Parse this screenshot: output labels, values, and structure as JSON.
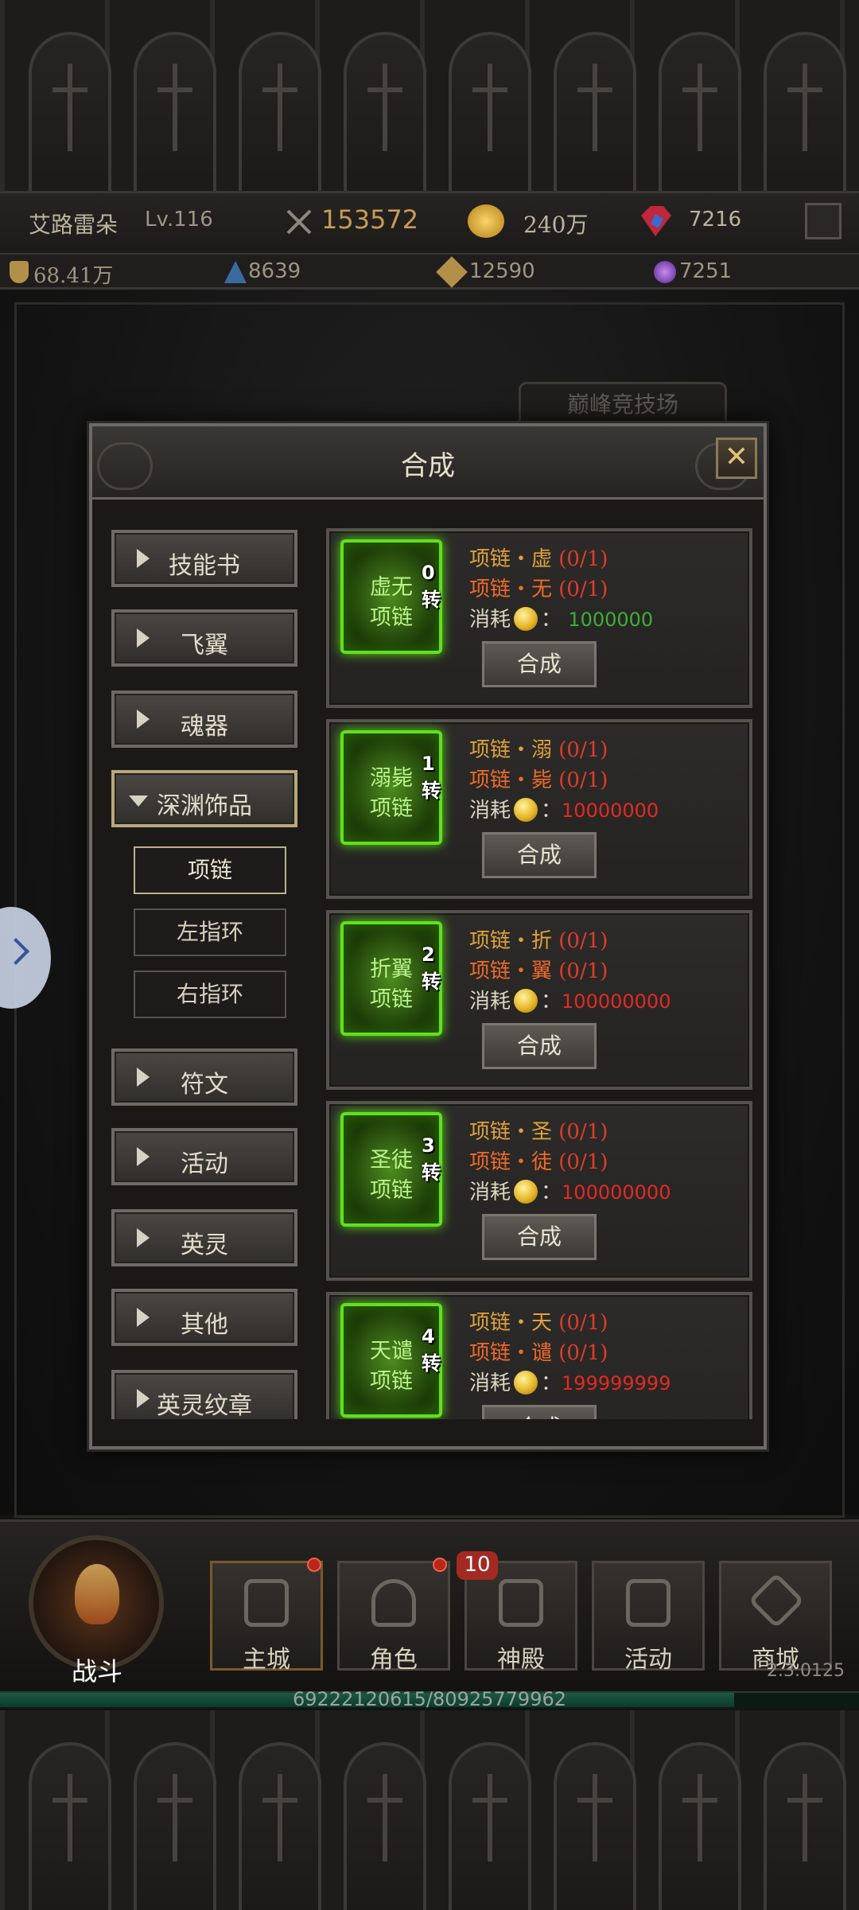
{
  "header": {
    "player_name": "艾路雷朵",
    "level": "Lv.116",
    "power": "153572",
    "gold": "240万",
    "gems": "7216",
    "stat_1": "68.41万",
    "stat_2": "8639",
    "stat_3": "12590",
    "stat_4": "7251"
  },
  "background": {
    "arena_sign": "巅峰竞技场"
  },
  "modal": {
    "title": "合成",
    "close_label": "✕"
  },
  "menu": {
    "categories": [
      {
        "label": "技能书"
      },
      {
        "label": "飞翼"
      },
      {
        "label": "魂器"
      },
      {
        "label": "深渊饰品"
      },
      {
        "label": "符文"
      },
      {
        "label": "活动"
      },
      {
        "label": "英灵"
      },
      {
        "label": "其他"
      },
      {
        "label": "英灵纹章"
      }
    ],
    "subitems": [
      {
        "label": "项链"
      },
      {
        "label": "左指环"
      },
      {
        "label": "右指环"
      }
    ]
  },
  "recipes": [
    {
      "item_line1": "虚无",
      "item_line2": "项链",
      "tier": "0转",
      "req1_name": "项链・虚",
      "req1_count": "(0/1)",
      "req2_name": "项链・无",
      "req2_count": "(0/1)",
      "cost_label": "消耗",
      "cost_sep": "：",
      "cost_value": "1000000",
      "affordable": true,
      "button": "合成"
    },
    {
      "item_line1": "溺毙",
      "item_line2": "项链",
      "tier": "1转",
      "req1_name": "项链・溺",
      "req1_count": "(0/1)",
      "req2_name": "项链・毙",
      "req2_count": "(0/1)",
      "cost_label": "消耗",
      "cost_sep": "：",
      "cost_value": "10000000",
      "affordable": false,
      "button": "合成"
    },
    {
      "item_line1": "折翼",
      "item_line2": "项链",
      "tier": "2转",
      "req1_name": "项链・折",
      "req1_count": "(0/1)",
      "req2_name": "项链・翼",
      "req2_count": "(0/1)",
      "cost_label": "消耗",
      "cost_sep": "：",
      "cost_value": "100000000",
      "affordable": false,
      "button": "合成"
    },
    {
      "item_line1": "圣徒",
      "item_line2": "项链",
      "tier": "3转",
      "req1_name": "项链・圣",
      "req1_count": "(0/1)",
      "req2_name": "项链・徒",
      "req2_count": "(0/1)",
      "cost_label": "消耗",
      "cost_sep": "：",
      "cost_value": "100000000",
      "affordable": false,
      "button": "合成"
    },
    {
      "item_line1": "天谴",
      "item_line2": "项链",
      "tier": "4转",
      "req1_name": "项链・天",
      "req1_count": "(0/1)",
      "req2_name": "项链・谴",
      "req2_count": "(0/1)",
      "cost_label": "消耗",
      "cost_sep": "：",
      "cost_value": "199999999",
      "affordable": false,
      "button": "合成"
    }
  ],
  "nav": {
    "battle": "战斗",
    "tabs": [
      {
        "label": "主城"
      },
      {
        "label": "角色"
      },
      {
        "label": "神殿"
      },
      {
        "label": "活动"
      },
      {
        "label": "商城"
      }
    ],
    "temple_badge": "10",
    "version": "2.3.0125",
    "exp_text": "69222120615/80925779962",
    "exp_fraction": 0.855
  },
  "colors": {
    "accent_gold": "#e0a13c",
    "missing_red": "#e03c2a",
    "affordable_green": "#3fae3a",
    "item_glow": "#5fe21a"
  }
}
